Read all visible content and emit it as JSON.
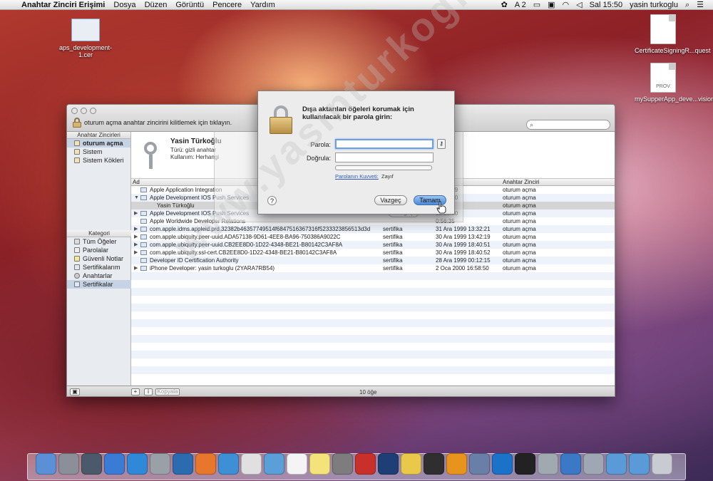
{
  "menubar": {
    "apple": "",
    "items": [
      "Anahtar Zinciri Erişimi",
      "Dosya",
      "Düzen",
      "Görüntü",
      "Pencere",
      "Yardım"
    ],
    "status": [
      "A 2",
      "Sal 15:50",
      "yasin turkoglu"
    ]
  },
  "desktop": {
    "left_icon": "aps_development-1.cer",
    "right_icons": [
      "CertificateSigningR...quest",
      "mySupperApp_deve...vision"
    ],
    "prov_label": "PROV"
  },
  "window": {
    "lock_text": "oturum açma anahtar zincirini kilitlemek için tıklayın.",
    "sidebar_header": "Anahtar Zincirleri",
    "keychains": [
      "oturum açma",
      "Sistem",
      "Sistem Kökleri"
    ],
    "category_header": "Kategori",
    "categories": [
      "Tüm Öğeler",
      "Parolalar",
      "Güvenli Notlar",
      "Sertifikalarım",
      "Anahtarlar",
      "Sertifikalar"
    ],
    "detail": {
      "title": "Yasin Türkoğlu",
      "type_label": "Türü: gizli anahtar",
      "usage_label": "Kullanım: Herhangi"
    },
    "columns": {
      "name": "Ad",
      "chain": "Anahtar Zinciri"
    },
    "rows": [
      {
        "tri": "",
        "name": "Apple Application Integration",
        "kind": "",
        "date": "21:16:09",
        "chain": "oturum açma"
      },
      {
        "tri": "▼",
        "name": "Apple Development IOS Push Services",
        "kind": "",
        "date": "14:48:30",
        "chain": "oturum açma"
      },
      {
        "tri": "",
        "name": "Yasin Türkoğlu",
        "kind": "",
        "date": "",
        "chain": "oturum açma"
      },
      {
        "tri": "▶",
        "name": "Apple Development IOS Push Services",
        "kind": "",
        "date": "12:23:00",
        "chain": "oturum açma"
      },
      {
        "tri": "",
        "name": "Apple Worldwide Developer Relations",
        "kind": "",
        "date": "0:56:35",
        "chain": "oturum açma"
      },
      {
        "tri": "▶",
        "name": "com.apple.idms.appleid.prd.32382b46357749514f6847516367316f5233323856513d3d",
        "kind": "sertifika",
        "date": "31 Ara 1999 13:32:21",
        "chain": "oturum açma"
      },
      {
        "tri": "▶",
        "name": "com.apple.ubiquity.peer-uuid.ADA57138-9D61-4EE8-BA96-750386A9022C",
        "kind": "sertifika",
        "date": "30 Ara 1999 13:42:19",
        "chain": "oturum açma"
      },
      {
        "tri": "▶",
        "name": "com.apple.ubiquity.peer-uuid.CB2EE8D0-1D22-4348-BE21-B80142C3AF8A",
        "kind": "sertifika",
        "date": "30 Ara 1999 18:40:51",
        "chain": "oturum açma"
      },
      {
        "tri": "▶",
        "name": "com.apple.ubiquity.ssl-cert.CB2EE8D0-1D22-4348-BE21-B80142C3AF8A",
        "kind": "sertifika",
        "date": "30 Ara 1999 18:40:52",
        "chain": "oturum açma"
      },
      {
        "tri": "",
        "name": "Developer ID Certification Authority",
        "kind": "sertifika",
        "date": "28 Ara 1999 00:12:15",
        "chain": "oturum açma"
      },
      {
        "tri": "▶",
        "name": "iPhone Developer: yasin turkoglu (2YARA7RB54)",
        "kind": "sertifika",
        "date": "2 Oca 2000 16:58:50",
        "chain": "oturum açma"
      }
    ],
    "bottom": {
      "copy_button": "Kopyala",
      "count": "10 öğe"
    },
    "behind_sheet": {
      "cancel": "Vazgeç"
    }
  },
  "dialog": {
    "message": "Dışa aktarılan öğeleri korumak için kullanılacak bir parola girin:",
    "password_label": "Parola:",
    "verify_label": "Doğrula:",
    "password_value": "",
    "verify_value": "",
    "quality_link": "Parolanın Kuvveti:",
    "quality_value": "Zayıf",
    "help": "?",
    "cancel": "Vazgeç",
    "ok": "Tamam"
  },
  "watermark": "www.yasinturkoglu.com",
  "dock": [
    "Finder",
    "Launchpad",
    "Mission Control",
    "iTunes",
    "App Store",
    "Preview",
    "Google Earth",
    "Firefox",
    "Safari",
    "Chrome",
    "Mail",
    "Calendar",
    "Stickies",
    "System Preferences",
    "FileZilla",
    "Photoshop",
    "Notes",
    "Activity Monitor",
    "Settings",
    "Xcode",
    "TeamViewer",
    "Terminal",
    "Utilities",
    "Instruments",
    "Keychain",
    "Documents",
    "Downloads",
    "Trash"
  ],
  "colors": {
    "accent": "#4b8bd9",
    "link": "#2f5bb7",
    "selection": "#c6d3e4"
  }
}
